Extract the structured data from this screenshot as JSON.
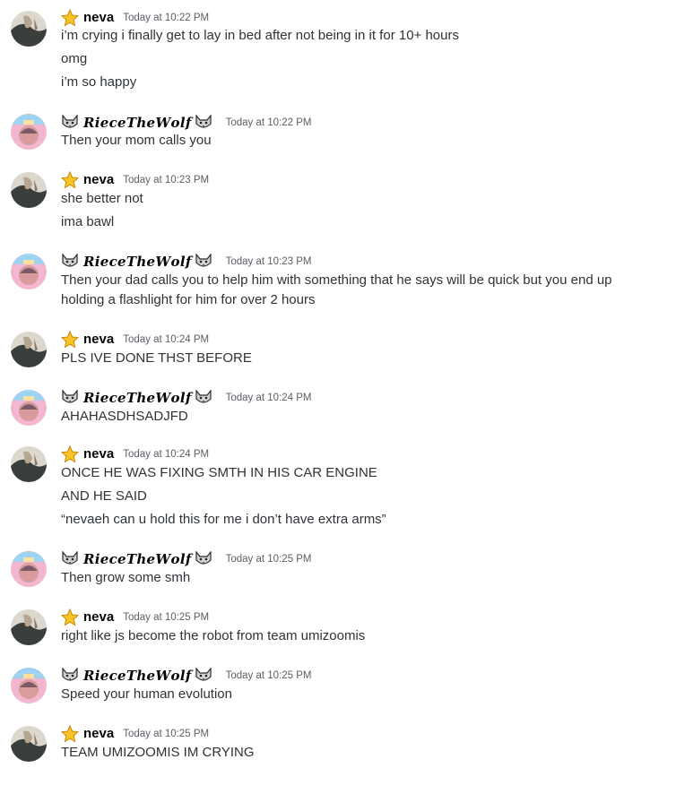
{
  "users": {
    "neva": {
      "name": "neva",
      "badge": "star-icon"
    },
    "riece": {
      "name": "𝑹𝒊𝒆𝒄𝒆𝑻𝒉𝒆𝑾𝒐𝒍𝒇",
      "badge": "wolf-icon"
    }
  },
  "messages": [
    {
      "author": "neva",
      "time": "Today at 10:22 PM",
      "lines": [
        "i’m crying i finally get to lay in bed after not being in it for 10+ hours",
        "omg",
        "i’m so happy"
      ]
    },
    {
      "author": "riece",
      "time": "Today at 10:22 PM",
      "lines": [
        "Then your mom calls you"
      ]
    },
    {
      "author": "neva",
      "time": "Today at 10:23 PM",
      "lines": [
        "she better not",
        "ima bawl"
      ]
    },
    {
      "author": "riece",
      "time": "Today at 10:23 PM",
      "lines": [
        "Then your dad calls you to help him with something that he says will be quick but you end up holding a flashlight for him for over 2 hours"
      ]
    },
    {
      "author": "neva",
      "time": "Today at 10:24 PM",
      "lines": [
        "PLS IVE DONE THST BEFORE"
      ]
    },
    {
      "author": "riece",
      "time": "Today at 10:24 PM",
      "lines": [
        "AHAHASDHSADJFD"
      ]
    },
    {
      "author": "neva",
      "time": "Today at 10:24 PM",
      "lines": [
        "ONCE HE WAS FIXING SMTH IN HIS CAR ENGINE",
        "AND HE SAID",
        "“nevaeh can u hold this for me i don’t have extra arms”"
      ]
    },
    {
      "author": "riece",
      "time": "Today at 10:25 PM",
      "lines": [
        "Then grow some smh"
      ]
    },
    {
      "author": "neva",
      "time": "Today at 10:25 PM",
      "lines": [
        "right like js become the robot from team umizoomis"
      ]
    },
    {
      "author": "riece",
      "time": "Today at 10:25 PM",
      "lines": [
        "Speed your human evolution"
      ]
    },
    {
      "author": "neva",
      "time": "Today at 10:25 PM",
      "lines": [
        "TEAM UMIZOOMIS IM CRYING"
      ]
    }
  ]
}
